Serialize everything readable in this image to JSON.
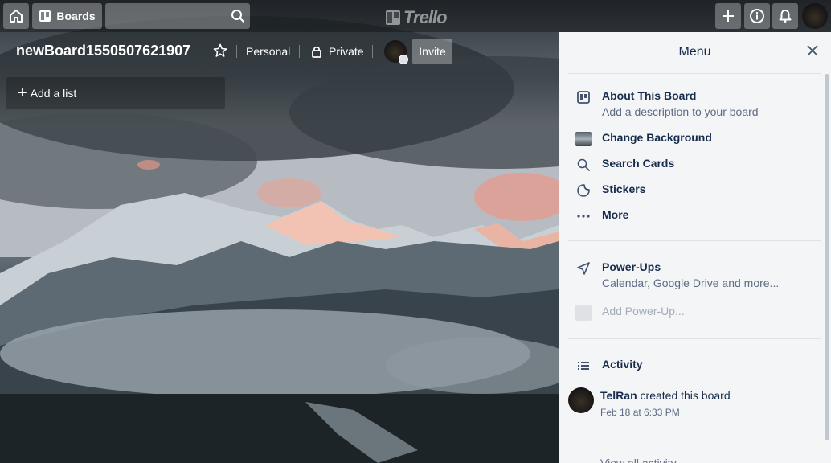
{
  "header": {
    "boards_label": "Boards",
    "search_value": "",
    "logo_text": "Trello"
  },
  "board": {
    "title": "newBoard1550507621907",
    "team_label": "Personal",
    "visibility_label": "Private",
    "invite_label": "Invite",
    "add_list_label": "Add a list"
  },
  "menu": {
    "title": "Menu",
    "items": [
      {
        "title": "About This Board",
        "subtitle": "Add a description to your board",
        "icon": "board-icon"
      },
      {
        "title": "Change Background",
        "icon": "background-thumbnail"
      },
      {
        "title": "Search Cards",
        "icon": "search-icon"
      },
      {
        "title": "Stickers",
        "icon": "sticker-icon"
      },
      {
        "title": "More",
        "icon": "ellipsis-icon"
      }
    ],
    "powerups": {
      "title": "Power-Ups",
      "subtitle": "Calendar, Google Drive and more...",
      "add_label": "Add Power-Up..."
    },
    "activity": {
      "title": "Activity",
      "entries": [
        {
          "user": "TelRan",
          "action": "created this board",
          "time": "Feb 18 at 6:33 PM"
        }
      ],
      "view_all_label": "View all activity..."
    }
  },
  "colors": {
    "menu_bg": "#f4f5f7",
    "text_primary": "#172b4d",
    "text_secondary": "#5e6c84"
  }
}
